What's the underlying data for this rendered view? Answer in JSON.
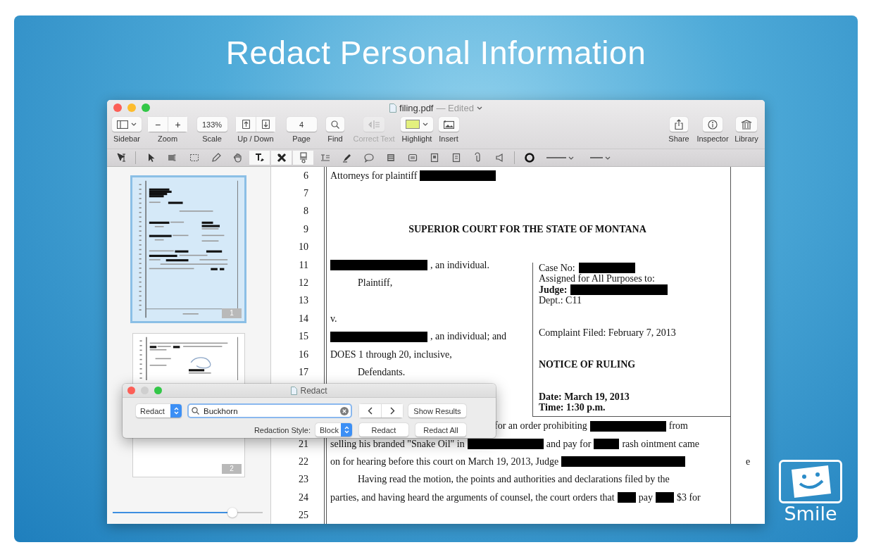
{
  "banner": {
    "title": "Redact Personal Information"
  },
  "window": {
    "title": "filing.pdf",
    "status": "— Edited"
  },
  "toolbar": {
    "left": [
      {
        "kind": "sidebar",
        "label": "Sidebar",
        "disabled": false
      },
      {
        "kind": "zoom",
        "label": "Zoom",
        "buttons": [
          "−",
          "+"
        ],
        "disabled": false
      },
      {
        "kind": "scale",
        "label": "Scale",
        "value": "133%",
        "disabled": false
      },
      {
        "kind": "updown",
        "label": "Up / Down",
        "disabled": false
      },
      {
        "kind": "page",
        "label": "Page",
        "value": "4",
        "disabled": false
      },
      {
        "kind": "find",
        "label": "Find",
        "disabled": false
      },
      {
        "kind": "correct_text",
        "label": "Correct Text",
        "disabled": true
      },
      {
        "kind": "highlight",
        "label": "Highlight",
        "disabled": false
      },
      {
        "kind": "insert",
        "label": "Insert",
        "disabled": false
      }
    ],
    "right": [
      {
        "kind": "share",
        "label": "Share",
        "disabled": false
      },
      {
        "kind": "inspector",
        "label": "Inspector",
        "disabled": false
      },
      {
        "kind": "library",
        "label": "Library",
        "disabled": false
      }
    ]
  },
  "annotation_tools": [
    {
      "kind": "text_cursor",
      "selected": false
    },
    {
      "kind": "pointer",
      "selected": false
    },
    {
      "kind": "text_select",
      "selected": false
    },
    {
      "kind": "rect_select",
      "selected": false
    },
    {
      "kind": "pencil",
      "selected": false
    },
    {
      "kind": "hand",
      "selected": false
    },
    {
      "kind": "text_pen",
      "selected": true
    },
    {
      "kind": "redact",
      "selected": true
    },
    {
      "kind": "stamp",
      "selected": true
    },
    {
      "kind": "text_box",
      "selected": false
    },
    {
      "kind": "highlighter",
      "selected": false
    },
    {
      "kind": "speech",
      "selected": false
    },
    {
      "kind": "note",
      "selected": false
    },
    {
      "kind": "form",
      "selected": false
    },
    {
      "kind": "image_box",
      "selected": false
    },
    {
      "kind": "file_box",
      "selected": false
    },
    {
      "kind": "clip",
      "selected": false
    },
    {
      "kind": "speaker",
      "selected": false
    },
    {
      "kind": "circle",
      "selected": false
    },
    {
      "kind": "line_style",
      "selected": false
    },
    {
      "kind": "line_width",
      "selected": false
    }
  ],
  "sidebar": {
    "thumbnails": [
      {
        "badge": "1",
        "selected": true
      },
      {
        "badge": "2",
        "selected": false
      }
    ],
    "thumbnail_size": {
      "level": 0.8
    }
  },
  "document": {
    "rows": [
      {
        "number": "6",
        "kind": "full",
        "segments": [
          {
            "kind": "text",
            "text": "Attorneys for plaintiff",
            "bold": false
          },
          {
            "kind": "redaction_long"
          }
        ]
      },
      {
        "number": "7",
        "kind": "blank"
      },
      {
        "number": "8",
        "kind": "blank"
      },
      {
        "number": "9",
        "kind": "heading",
        "segments": [
          {
            "kind": "text",
            "text": "SUPERIOR COURT FOR THE STATE OF MONTANA",
            "bold": true
          }
        ]
      },
      {
        "number": "10",
        "kind": "blank"
      },
      {
        "number": "11",
        "kind": "split",
        "segments": [
          {
            "kind": "redaction_xlong"
          },
          {
            "kind": "text",
            "text": ", an individual.",
            "bold": false
          }
        ]
      },
      {
        "number": "12",
        "kind": "split",
        "indent": true,
        "segments": [
          {
            "kind": "text",
            "text": "Plaintiff,",
            "bold": false
          }
        ]
      },
      {
        "number": "13",
        "kind": "split"
      },
      {
        "number": "14",
        "kind": "split",
        "segments": [
          {
            "kind": "text",
            "text": "v.",
            "bold": false
          }
        ]
      },
      {
        "number": "15",
        "kind": "split",
        "segments": [
          {
            "kind": "redaction_xlong"
          },
          {
            "kind": "text",
            "text": ", an individual; and",
            "bold": false
          }
        ]
      },
      {
        "number": "16",
        "kind": "split",
        "segments": [
          {
            "kind": "text",
            "text": "DOES 1 through 20, inclusive,",
            "bold": false
          }
        ]
      },
      {
        "number": "17",
        "kind": "split",
        "indent": true,
        "segments": [
          {
            "kind": "text",
            "text": "Defendants.",
            "bold": false
          }
        ]
      },
      {
        "kind": "split"
      },
      {
        "kind": "split"
      },
      {
        "kind": "partial",
        "segments": [
          {
            "kind": "text",
            "text": "for an order prohibiting",
            "bold": false
          },
          {
            "kind": "redaction_long"
          },
          {
            "kind": "text",
            "text": "from",
            "bold": false
          }
        ]
      },
      {
        "number": "21",
        "kind": "full",
        "segments": [
          {
            "kind": "text",
            "text": "selling his branded \"Snake Oil\" in",
            "bold": false
          },
          {
            "kind": "redaction_long"
          },
          {
            "kind": "text",
            "text": "and pay for",
            "bold": false
          },
          {
            "kind": "redaction_short"
          },
          {
            "kind": "text",
            "text": "rash ointment came",
            "bold": false
          }
        ]
      },
      {
        "number": "22",
        "kind": "full",
        "margin": "e",
        "segments": [
          {
            "kind": "text",
            "text": "on for hearing before this court on March 19, 2013, Judge",
            "bold": false
          },
          {
            "kind": "redaction_xxlong"
          }
        ]
      },
      {
        "number": "23",
        "kind": "full",
        "indent": true,
        "segments": [
          {
            "kind": "text",
            "text": "Having read the motion, the points and authorities and declarations filed by the",
            "bold": false
          }
        ]
      },
      {
        "number": "24",
        "kind": "full",
        "segments": [
          {
            "kind": "text",
            "text": "parties, and having heard the arguments of counsel, the court orders that",
            "bold": false
          },
          {
            "kind": "redaction_tiny"
          },
          {
            "kind": "text",
            "text": "pay",
            "bold": false
          },
          {
            "kind": "redaction_tiny"
          },
          {
            "kind": "text",
            "text": "$3 for",
            "bold": false
          }
        ]
      },
      {
        "number": "25",
        "kind": "blank"
      }
    ],
    "right_column": [
      [
        {
          "segments": [
            {
              "kind": "text",
              "text": "Case No:",
              "bold": false
            },
            {
              "kind": "redaction_medium"
            }
          ]
        },
        {
          "segments": [
            {
              "kind": "text",
              "text": "Assigned for All Purposes to:",
              "bold": false
            }
          ]
        },
        {
          "segments": [
            {
              "kind": "text",
              "text": "Judge:",
              "bold": true
            },
            {
              "kind": "redaction_xlong"
            }
          ]
        },
        {
          "segments": [
            {
              "kind": "text",
              "text": "Dept.: C11",
              "bold": false
            }
          ]
        }
      ],
      [
        {
          "segments": [
            {
              "kind": "text",
              "text": "Complaint Filed: February 7, 2013",
              "bold": false
            }
          ]
        }
      ],
      [
        {
          "segments": [
            {
              "kind": "text",
              "text": "NOTICE OF RULING",
              "bold": true
            }
          ]
        }
      ],
      [
        {
          "segments": [
            {
              "kind": "text",
              "text": "Date: March 19, 2013",
              "bold": true
            }
          ]
        },
        {
          "segments": [
            {
              "kind": "text",
              "text": "Time: 1:30 p.m.",
              "bold": true
            }
          ]
        }
      ]
    ]
  },
  "redact_dialog": {
    "title": "Redact",
    "mode": "Redact",
    "search": {
      "value": "Buckhorn"
    },
    "show_results": "Show Results",
    "style_label": "Redaction Style:",
    "style": "Block",
    "buttons": [
      "Redact",
      "Redact All"
    ]
  },
  "logo": {
    "text": "Smile"
  }
}
